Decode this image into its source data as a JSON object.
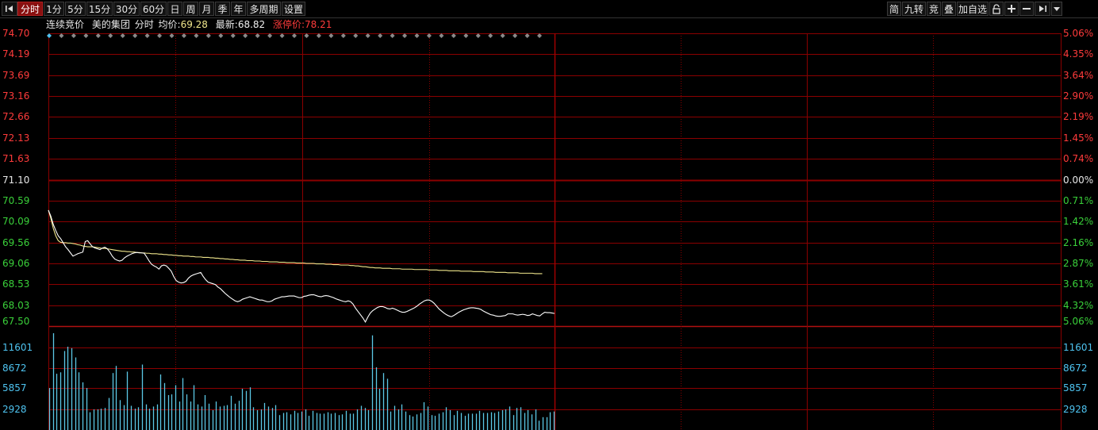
{
  "toolbar": {
    "items": [
      "分时",
      "1分",
      "5分",
      "15分",
      "30分",
      "60分",
      "日",
      "周",
      "月",
      "季",
      "年",
      "多周期",
      "设置"
    ],
    "active_index": 0,
    "right_items": [
      "简",
      "九转",
      "竞",
      "叠",
      "加自选"
    ]
  },
  "info": {
    "mode": "连续竞价",
    "stock": "美的集团",
    "view": "分时",
    "avg_label": "均价:",
    "avg_value": "69.28",
    "last_label": "最新:",
    "last_value": "68.82",
    "limit_label": "涨停价:",
    "limit_value": "78.21"
  },
  "axes": {
    "price_labels": [
      "74.70",
      "74.19",
      "73.69",
      "73.16",
      "72.66",
      "72.13",
      "71.63",
      "71.10",
      "70.59",
      "70.09",
      "69.56",
      "69.06",
      "68.53",
      "68.03",
      "67.50"
    ],
    "pct_labels": [
      "5.06%",
      "4.35%",
      "3.64%",
      "2.90%",
      "2.19%",
      "1.45%",
      "0.74%",
      "0.00%",
      "0.71%",
      "1.42%",
      "2.16%",
      "2.87%",
      "3.61%",
      "4.32%",
      "5.06%"
    ],
    "volume_labels": [
      "11601",
      "8672",
      "5857",
      "2928"
    ],
    "prev_close": 71.1
  },
  "colors": {
    "up": "#ff3b3b",
    "zero": "#e8e8e8",
    "down": "#3ad13a",
    "grid": "#8b0000",
    "volume": "#5bc8e6",
    "volume_axis": "#4ec3f0",
    "price_line": "#ffffff",
    "avg_line": "#f0e68c",
    "diamond": "#8a8a8a"
  },
  "chart_data": {
    "type": "line",
    "series": [
      {
        "values": [
          70.35,
          70.2,
          70.0,
          69.85,
          69.72,
          69.65,
          69.55,
          69.45,
          69.38,
          69.3,
          69.22,
          69.25,
          69.28,
          69.3,
          69.32,
          69.58,
          69.6,
          69.52,
          69.45,
          69.42,
          69.4,
          69.38,
          69.42,
          69.44,
          69.4,
          69.32,
          69.22,
          69.15,
          69.12,
          69.1,
          69.12,
          69.18,
          69.22,
          69.25,
          69.28,
          69.3,
          69.31,
          69.3,
          69.3,
          69.29,
          69.2,
          69.1,
          69.02,
          68.98,
          68.95,
          68.9,
          68.98,
          69.0,
          68.98,
          68.92,
          68.85,
          68.72,
          68.62,
          68.58,
          68.56,
          68.57,
          68.6,
          68.68,
          68.73,
          68.76,
          68.78,
          68.8,
          68.82,
          68.72,
          68.64,
          68.58,
          68.56,
          68.54,
          68.52,
          68.46,
          68.42,
          68.36,
          68.3,
          68.25,
          68.2,
          68.16,
          68.12,
          68.1,
          68.12,
          68.16,
          68.18,
          68.2,
          68.22,
          68.2,
          68.18,
          68.16,
          68.14,
          68.14,
          68.12,
          68.1,
          68.1,
          68.12,
          68.16,
          68.18,
          68.2,
          68.22,
          68.22,
          68.23,
          68.24,
          68.24,
          68.24,
          68.22,
          68.2,
          68.2,
          68.23,
          68.24,
          68.26,
          68.27,
          68.27,
          68.25,
          68.23,
          68.22,
          68.24,
          68.25,
          68.24,
          68.22,
          68.2,
          68.17,
          68.15,
          68.13,
          68.11,
          68.1,
          68.12,
          68.1,
          68.04,
          67.94,
          67.86,
          67.78,
          67.7,
          67.6,
          67.72,
          67.82,
          67.88,
          67.92,
          67.96,
          67.98,
          67.98,
          67.96,
          67.93,
          67.92,
          67.94,
          67.92,
          67.89,
          67.86,
          67.84,
          67.84,
          67.86,
          67.89,
          67.92,
          67.95,
          67.99,
          68.04,
          68.08,
          68.12,
          68.14,
          68.14,
          68.11,
          68.06,
          67.99,
          67.92,
          67.87,
          67.82,
          67.78,
          67.75,
          67.73,
          67.76,
          67.8,
          67.84,
          67.87,
          67.9,
          67.92,
          67.94,
          67.95,
          67.95,
          67.94,
          67.93,
          67.91,
          67.87,
          67.84,
          67.81,
          67.78,
          67.77,
          67.75,
          67.74,
          67.74,
          67.75,
          67.76,
          67.8,
          67.8,
          67.8,
          67.78,
          67.77,
          67.78,
          67.79,
          67.78,
          67.76,
          67.77,
          67.8,
          67.78,
          67.76,
          67.75,
          67.8,
          67.84,
          67.83,
          67.83,
          67.82,
          67.81
        ]
      },
      {
        "values": [
          70.35,
          70.15,
          69.9,
          69.72,
          69.6,
          69.56,
          69.55,
          69.55,
          69.54,
          69.54,
          69.53,
          69.52,
          69.5,
          69.49,
          69.47,
          69.46,
          69.45,
          69.45,
          69.45,
          69.44,
          69.43,
          69.42,
          69.41,
          69.41,
          69.4,
          69.39,
          69.38,
          69.37,
          69.36,
          69.35,
          69.34,
          69.34,
          69.33,
          69.33,
          69.32,
          69.32,
          69.31,
          69.31,
          69.3,
          69.3,
          69.29,
          69.29,
          69.28,
          69.28,
          69.28,
          69.27,
          69.27,
          69.26,
          69.26,
          69.25,
          69.25,
          69.24,
          69.24,
          69.23,
          69.23,
          69.22,
          69.22,
          69.22,
          69.21,
          69.21,
          69.2,
          69.2,
          69.2,
          69.19,
          69.19,
          69.19,
          69.18,
          69.18,
          69.17,
          69.17,
          69.16,
          69.16,
          69.15,
          69.15,
          69.14,
          69.14,
          69.13,
          69.13,
          69.12,
          69.12,
          69.12,
          69.11,
          69.11,
          69.11,
          69.1,
          69.1,
          69.1,
          69.09,
          69.09,
          69.09,
          69.08,
          69.08,
          69.08,
          69.08,
          69.07,
          69.07,
          69.07,
          69.06,
          69.06,
          69.06,
          69.06,
          69.05,
          69.05,
          69.05,
          69.05,
          69.04,
          69.04,
          69.04,
          69.04,
          69.03,
          69.03,
          69.03,
          69.03,
          69.02,
          69.02,
          69.02,
          69.01,
          69.01,
          69.01,
          69.0,
          69.0,
          69.0,
          69.0,
          68.99,
          68.99,
          68.98,
          68.98,
          68.97,
          68.96,
          68.96,
          68.95,
          68.94,
          68.94,
          68.93,
          68.93,
          68.93,
          68.92,
          68.92,
          68.92,
          68.92,
          68.91,
          68.91,
          68.91,
          68.91,
          68.9,
          68.9,
          68.9,
          68.9,
          68.9,
          68.89,
          68.89,
          68.89,
          68.89,
          68.89,
          68.89,
          68.88,
          68.88,
          68.88,
          68.88,
          68.87,
          68.87,
          68.87,
          68.87,
          68.86,
          68.86,
          68.86,
          68.86,
          68.86,
          68.85,
          68.85,
          68.85,
          68.85,
          68.85,
          68.84,
          68.84,
          68.84,
          68.84,
          68.84,
          68.83,
          68.83,
          68.83,
          68.83,
          68.82,
          68.82,
          68.82,
          68.82,
          68.82,
          68.81,
          68.81,
          68.81,
          68.81,
          68.81,
          68.8,
          68.8,
          68.8,
          68.8,
          68.8,
          68.8,
          68.79,
          68.79,
          68.79,
          68.79
        ]
      }
    ],
    "volume": [
      5900,
      13600,
      7900,
      8100,
      11100,
      11700,
      11500,
      10200,
      8100,
      6700,
      5900,
      2500,
      2900,
      2900,
      3000,
      3100,
      4500,
      8000,
      9000,
      4200,
      3500,
      8200,
      3400,
      3000,
      3200,
      9200,
      3600,
      3000,
      3300,
      3600,
      7800,
      6600,
      4900,
      5000,
      6300,
      4000,
      7300,
      5000,
      4000,
      6300,
      3600,
      3300,
      4900,
      3700,
      2800,
      4000,
      3300,
      3400,
      3500,
      4800,
      3700,
      4100,
      5800,
      5500,
      6000,
      3200,
      2800,
      2900,
      3800,
      3300,
      3100,
      3500,
      2100,
      2400,
      2500,
      2200,
      2700,
      2400,
      2600,
      2900,
      2000,
      2700,
      2400,
      2300,
      2300,
      2500,
      2300,
      2400,
      2100,
      2200,
      2700,
      2300,
      2300,
      2900,
      3400,
      3100,
      2800,
      13300,
      8800,
      5800,
      8000,
      7200,
      2600,
      3400,
      2900,
      3600,
      2600,
      2100,
      1900,
      2200,
      2400,
      3900,
      3300,
      2100,
      2000,
      2300,
      2500,
      3200,
      2800,
      2100,
      2700,
      2400,
      2000,
      2300,
      2300,
      2300,
      2700,
      2400,
      2400,
      2500,
      2400,
      2600,
      2800,
      2900,
      3300,
      2100,
      3100,
      3200,
      2400,
      2800,
      2200,
      2900,
      1300,
      1800,
      1800,
      2500,
      2600
    ]
  }
}
